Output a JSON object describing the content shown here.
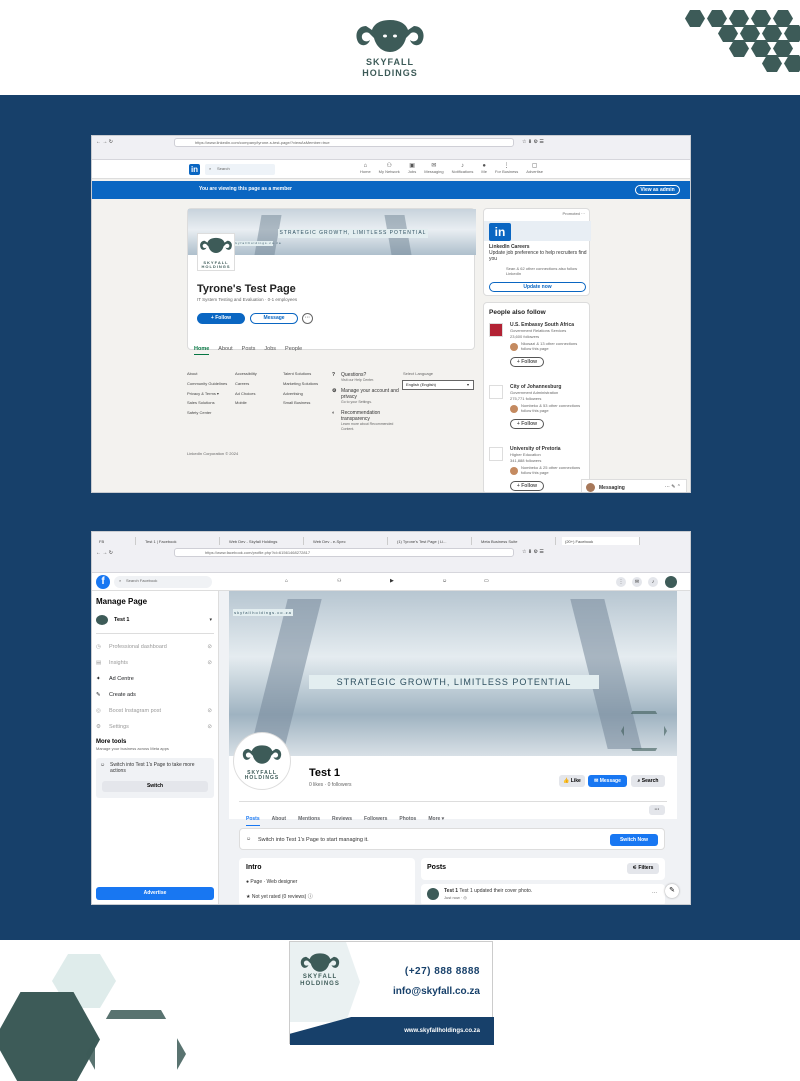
{
  "brand": {
    "name_line1": "SKYFALL",
    "name_line2": "HOLDINGS"
  },
  "colors": {
    "navy": "#17406a",
    "teal": "#3d5b58",
    "linkedin_blue": "#0a66c2",
    "facebook_blue": "#1877f2"
  },
  "linkedin": {
    "url": "https://www.linkedin.com/company/tyrone-s-test-page/?viewAsMember=true",
    "bookmarks": [
      "Import bookmarks...",
      "Most Visited",
      "Getting Started",
      "Creation Staff",
      "Antiques",
      "Indeed - all accounts...",
      "Raspberry Pi",
      "Social Media",
      "Today in History",
      "Postie Links",
      "Brew",
      "TV Actuator",
      "Camping",
      "British Citizenship |...",
      "Sony Professional |..."
    ],
    "search_placeholder": "Search",
    "nav": [
      "Home",
      "My Network",
      "Jobs",
      "Messaging",
      "Notifications",
      "Me",
      "For Business",
      "Advertise"
    ],
    "member_banner": "You are viewing this page as a member",
    "view_as_admin": "View as admin",
    "cover_tagline": "STRATEGIC GROWTH, LIMITLESS POTENTIAL",
    "cover_site": "skyfallholdings.co.za",
    "page_title": "Tyrone's Test Page",
    "page_subtitle": "IT System Testing and Evaluation · 0-1 employees",
    "follow": "+ Follow",
    "message": "Message",
    "more": "···",
    "tabs": [
      "Home",
      "About",
      "Posts",
      "Jobs",
      "People"
    ],
    "footer_col1": [
      "About",
      "Community Guidelines",
      "Privacy & Terms ▾",
      "Sales Solutions",
      "Safety Center"
    ],
    "footer_col2": [
      "Accessibility",
      "Careers",
      "Ad Choices",
      "Mobile"
    ],
    "footer_col3": [
      "Talent Solutions",
      "Marketing Solutions",
      "Advertising",
      "Small Business"
    ],
    "help": [
      {
        "title": "Questions?",
        "sub": "Visit our Help Center."
      },
      {
        "title": "Manage your account and privacy",
        "sub": "Go to your Settings."
      },
      {
        "title": "Recommendation transparency",
        "sub": "Learn more about Recommended Content."
      }
    ],
    "select_language_label": "Select Language",
    "language": "English (English)",
    "copyright": "LinkedIn Corporation © 2024",
    "ad": {
      "promoted": "Promoted ···",
      "title": "LinkedIn Careers",
      "body": "Update job preference to help recruiters find you",
      "social": "Sean & 62 other connections also follow LinkedIn",
      "cta": "Update now"
    },
    "people_also_follow": "People also follow",
    "suggestions": [
      {
        "name": "U.S. Embassy South Africa",
        "sector": "Government Relations Services",
        "followers": "23,600 followers",
        "mutual": "Nkosazi & 13 other connections follow this page",
        "button": "+ Follow"
      },
      {
        "name": "City of Johannesburg",
        "sector": "Government Administration",
        "followers": "275,771 followers",
        "mutual": "Nombeko & 53 other connections follow this page",
        "button": "+ Follow"
      },
      {
        "name": "University of Pretoria",
        "sector": "Higher Education",
        "followers": "341,888 followers",
        "mutual": "Nombeko & 25 other connections follow this page",
        "button": "+ Follow"
      }
    ],
    "messaging": "Messaging"
  },
  "facebook": {
    "tabs": [
      "FB",
      "Test 1 | Facebook",
      "Web Dev - Skyfall Holdings",
      "Web Dev - e-Spec",
      "(1) Tyrone's Test Page | Li...",
      "Meta Business Suite",
      "(20+) Facebook"
    ],
    "url": "https://www.facebook.com/profile.php?id=61561468272817",
    "bookmarks": [
      "Import bookmarks...",
      "Most Visited",
      "Getting Started",
      "Creation Staff",
      "Antiques",
      "Indeed - all accounts...",
      "Raspberry Pi",
      "Social Media",
      "Today in History",
      "Postie Links",
      "Brew",
      "TV Actuator",
      "Camping",
      "British Citizenship |...",
      "Sony Professional |..."
    ],
    "search_placeholder": "Search Facebook",
    "manage_page": "Manage Page",
    "page_name": "Test 1",
    "menu": [
      {
        "label": "Professional dashboard",
        "dim": true
      },
      {
        "label": "Insights",
        "dim": true
      },
      {
        "label": "Ad Centre",
        "dim": false
      },
      {
        "label": "Create ads",
        "dim": false
      },
      {
        "label": "Boost Instagram post",
        "dim": true
      },
      {
        "label": "Settings",
        "dim": true
      }
    ],
    "more_tools": "More tools",
    "more_tools_sub": "Manage your business across Meta apps",
    "switch_prompt": "Switch into Test 1's Page to take more actions",
    "switch": "Switch",
    "advertise": "Advertise",
    "cover_tagline": "STRATEGIC GROWTH, LIMITLESS POTENTIAL",
    "cover_site": "skyfallholdings.co.za",
    "profile_title": "Test 1",
    "profile_stats": "0 likes · 0 followers",
    "like": "Like",
    "message": "Message",
    "search": "Search",
    "page_tabs": [
      "Posts",
      "About",
      "Mentions",
      "Reviews",
      "Followers",
      "Photos",
      "More ▾"
    ],
    "switch_banner": "Switch into Test 1's Page to start managing it.",
    "switch_now": "Switch Now",
    "intro": "Intro",
    "intro_items": [
      "Page · Web designer",
      "Not yet rated (0 reviews)"
    ],
    "posts": "Posts",
    "filters": "Filters",
    "post_text": "Test 1 updated their cover photo.",
    "post_time": "Just now · ◎"
  },
  "card": {
    "phone": "(+27) 888 8888",
    "email": "info@skyfall.co.za",
    "website": "www.skyfallholdings.co.za"
  }
}
